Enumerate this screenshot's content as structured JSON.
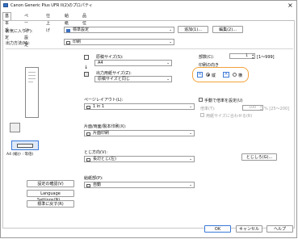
{
  "window": {
    "title": "Canon Generic Plus UFR II(2)のプロパティ",
    "close": "×"
  },
  "tabs": [
    "基本設定",
    "ページ設定",
    "仕上げ",
    "給紙",
    "品位"
  ],
  "profile": {
    "label": "お気に入り(F):",
    "value": "標準設定",
    "add": "追加(1)...",
    "edit": "編集(2)..."
  },
  "output": {
    "label": "出力方法(M):",
    "value": "印刷"
  },
  "paper": {
    "original_size_label": "原稿サイズ(S):",
    "original_size_value": "A4",
    "output_size_label": "出力用紙サイズ(Z):",
    "output_size_value": "原稿サイズと同じ"
  },
  "copies": {
    "label": "部数(C):",
    "value": "1",
    "range": "[1～999]"
  },
  "orientation": {
    "label": "印刷の向き",
    "portrait": "縦",
    "landscape": "横",
    "selected": "portrait"
  },
  "layout": {
    "label": "ページレイアウト(L):",
    "value": "1 in 1"
  },
  "scaling": {
    "manual_label": "手動で倍率を設定(U)",
    "ratio_label": "倍率(T):",
    "ratio_value": "100",
    "ratio_range": "% [25～200]",
    "match_paper_label": "用紙サイズに合わせる(R)"
  },
  "duplex": {
    "label": "片面/両面/製本印刷(X):",
    "value": "片面印刷"
  },
  "binding": {
    "label": "とじ方向(V):",
    "value": "長辺とじ(左)",
    "gutter": "とじしろ(G)..."
  },
  "paper_source": {
    "label": "給紙部(P):",
    "value": "自動"
  },
  "preview": {
    "caption": "A4 (縮小 : 等倍)"
  },
  "left_buttons": {
    "confirm": "設定の確認(V)",
    "language": "Language Settings(N)...",
    "restore": "標準に戻す(R)"
  },
  "footer": {
    "ok": "OK",
    "cancel": "キャンセル",
    "help": "ヘルプ"
  },
  "colors": {
    "accent": "#3a79d8",
    "highlight": "#f3a23a"
  }
}
